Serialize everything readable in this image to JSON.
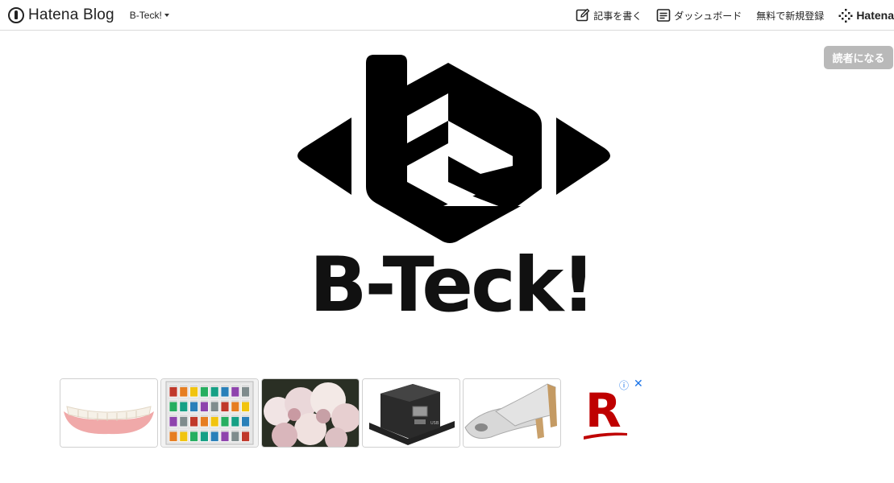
{
  "topbar": {
    "brand": "Hatena Blog",
    "blog_selector": "B-Teck!",
    "nav": {
      "write": "記事を書く",
      "dashboard": "ダッシュボード",
      "signup": "無料で新規登録",
      "hatena": "Hatena"
    }
  },
  "subscribe_label": "読者になる",
  "hero": {
    "title": "B-Teck!"
  },
  "ad": {
    "tiles": [
      "dentures",
      "watercolor-paint-set",
      "hydrangea-flowers",
      "network-device-box",
      "silver-pumps-shoes"
    ],
    "info_icon": "ⓘ",
    "close_icon": "✕",
    "advertiser_logo": "R"
  },
  "colors": {
    "accent_blue": "#1a73e8",
    "rakuten_red": "#bf0000",
    "subscribe_gray": "#b9b9b9"
  }
}
